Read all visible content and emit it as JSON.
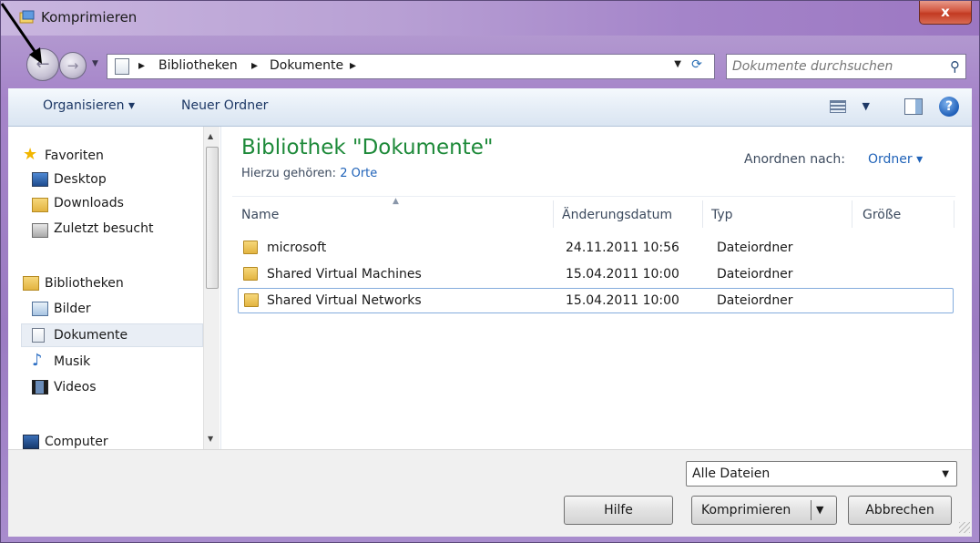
{
  "window": {
    "title": "Komprimieren",
    "close_label": "x"
  },
  "nav": {
    "breadcrumbs": [
      "Bibliotheken",
      "Dokumente"
    ],
    "search_placeholder": "Dokumente durchsuchen"
  },
  "toolbar": {
    "organize_label": "Organisieren ▾",
    "new_folder_label": "Neuer Ordner"
  },
  "sidebar": {
    "favorites_label": "Favoriten",
    "favorites": [
      "Desktop",
      "Downloads",
      "Zuletzt besucht"
    ],
    "libraries_label": "Bibliotheken",
    "libraries": [
      "Bilder",
      "Dokumente",
      "Musik",
      "Videos"
    ],
    "computer_label": "Computer",
    "selected": "Dokumente"
  },
  "main": {
    "title": "Bibliothek \"Dokumente\"",
    "subtitle_prefix": "Hierzu gehören:",
    "subtitle_link": "2 Orte",
    "arrange_label": "Anordnen nach:",
    "arrange_value": "Ordner ▾",
    "columns": [
      "Name",
      "Änderungsdatum",
      "Typ",
      "Größe"
    ],
    "rows": [
      {
        "name": "microsoft",
        "date": "24.11.2011 10:56",
        "type": "Dateiordner",
        "size": ""
      },
      {
        "name": "Shared Virtual Machines",
        "date": "15.04.2011 10:00",
        "type": "Dateiordner",
        "size": ""
      },
      {
        "name": "Shared Virtual Networks",
        "date": "15.04.2011 10:00",
        "type": "Dateiordner",
        "size": ""
      }
    ]
  },
  "bottom": {
    "filter_value": "Alle Dateien",
    "help_label": "Hilfe",
    "compress_label": "Komprimieren",
    "cancel_label": "Abbrechen"
  },
  "colors": {
    "title_green": "#1e8a3a",
    "link_blue": "#1f62b8",
    "chrome_purple": "#a584c9"
  }
}
